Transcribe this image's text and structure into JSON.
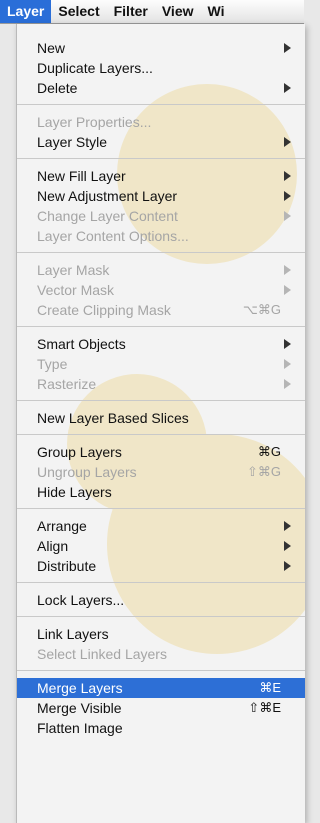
{
  "menubar": {
    "items": [
      "Layer",
      "Select",
      "Filter",
      "View",
      "Wi"
    ]
  },
  "menu": {
    "groups": [
      [
        {
          "label": "New",
          "submenu": true,
          "enabled": true
        },
        {
          "label": "Duplicate Layers...",
          "enabled": true
        },
        {
          "label": "Delete",
          "submenu": true,
          "enabled": true
        }
      ],
      [
        {
          "label": "Layer Properties...",
          "enabled": false
        },
        {
          "label": "Layer Style",
          "submenu": true,
          "enabled": true
        }
      ],
      [
        {
          "label": "New Fill Layer",
          "submenu": true,
          "enabled": true
        },
        {
          "label": "New Adjustment Layer",
          "submenu": true,
          "enabled": true
        },
        {
          "label": "Change Layer Content",
          "submenu": true,
          "enabled": false
        },
        {
          "label": "Layer Content Options...",
          "enabled": false
        }
      ],
      [
        {
          "label": "Layer Mask",
          "submenu": true,
          "enabled": false
        },
        {
          "label": "Vector Mask",
          "submenu": true,
          "enabled": false
        },
        {
          "label": "Create Clipping Mask",
          "shortcut": "⌥⌘G",
          "enabled": false
        }
      ],
      [
        {
          "label": "Smart Objects",
          "submenu": true,
          "enabled": true
        },
        {
          "label": "Type",
          "submenu": true,
          "enabled": false
        },
        {
          "label": "Rasterize",
          "submenu": true,
          "enabled": false
        }
      ],
      [
        {
          "label": "New Layer Based Slices",
          "enabled": true
        }
      ],
      [
        {
          "label": "Group Layers",
          "shortcut": "⌘G",
          "enabled": true
        },
        {
          "label": "Ungroup Layers",
          "shortcut": "⇧⌘G",
          "enabled": false
        },
        {
          "label": "Hide Layers",
          "enabled": true
        }
      ],
      [
        {
          "label": "Arrange",
          "submenu": true,
          "enabled": true
        },
        {
          "label": "Align",
          "submenu": true,
          "enabled": true
        },
        {
          "label": "Distribute",
          "submenu": true,
          "enabled": true
        }
      ],
      [
        {
          "label": "Lock Layers...",
          "enabled": true
        }
      ],
      [
        {
          "label": "Link Layers",
          "enabled": true
        },
        {
          "label": "Select Linked Layers",
          "enabled": false
        }
      ],
      [
        {
          "label": "Merge Layers",
          "shortcut": "⌘E",
          "enabled": true,
          "selected": true
        },
        {
          "label": "Merge Visible",
          "shortcut": "⇧⌘E",
          "enabled": true
        },
        {
          "label": "Flatten Image",
          "enabled": true
        }
      ]
    ]
  },
  "colors": {
    "highlight": "#2d6fd6",
    "disabled_text": "#a5a5a5",
    "menu_bg": "#f3f3f3"
  }
}
